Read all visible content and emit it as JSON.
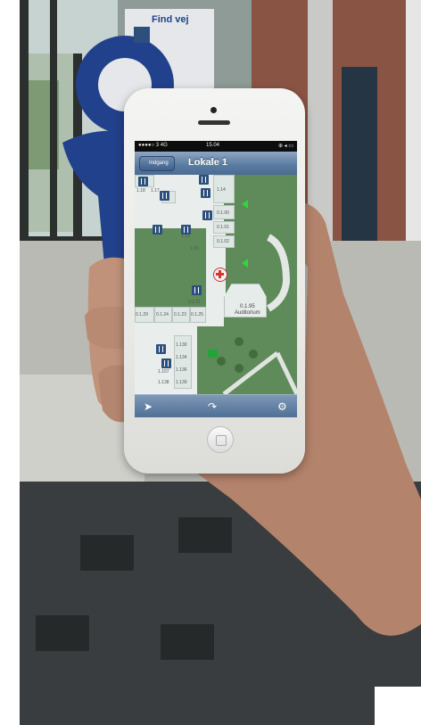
{
  "colors": {
    "navbar": "#5d7ea3",
    "map_green": "#5f8a5a",
    "room": "#dfe7e4",
    "icon_blue": "#2d4f7c",
    "arrow_green": "#2bd93a",
    "marker_red": "#d32222"
  },
  "background_sign": {
    "title": "Find vej"
  },
  "status_bar": {
    "carrier": "●●●●○ 3  4G",
    "time": "15.04",
    "indicators": "⊕ ◂ ▭"
  },
  "nav": {
    "back_label": "Indgang",
    "title": "Lokale 1"
  },
  "map": {
    "rooms": [
      "1.18",
      "1.17",
      "1.14",
      "1.13",
      "1.12",
      "1.15",
      "0.1.00",
      "0.1.01",
      "0.1.02",
      "0.1.21",
      "0.1.29",
      "0.1.24",
      "0.1.23",
      "0.1.25",
      "1.130",
      "1.134",
      "1.136",
      "1.157",
      "1.138",
      "1.139"
    ],
    "auditorium_number": "0.1.95",
    "auditorium_name": "Auditorium",
    "marker_icon": "red-cross-location-icon"
  },
  "toolbar": {
    "locate_icon": "location-arrow-icon",
    "route_icon": "route-arrow-icon",
    "settings_icon": "gear-icon"
  }
}
